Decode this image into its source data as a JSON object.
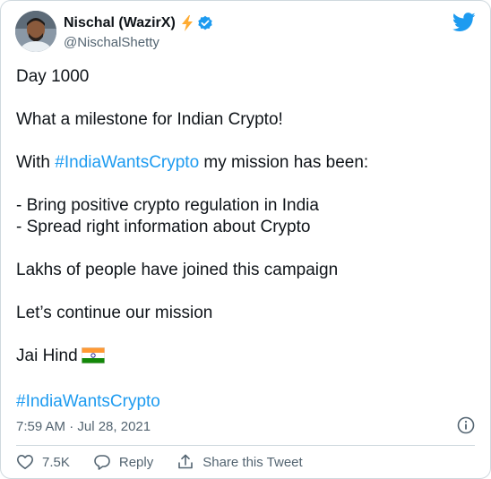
{
  "author": {
    "name": "Nischal (WazirX)",
    "handle": "@NischalShetty",
    "badges": [
      "lightning-bolt-icon",
      "verified-badge-icon"
    ]
  },
  "logo": "twitter-bird-icon",
  "tweet": {
    "lines": {
      "day": "Day 1000",
      "milestone": "What a milestone for Indian Crypto!",
      "mission_prefix": "With ",
      "mission_hashtag": "#IndiaWantsCrypto",
      "mission_suffix": " my mission has been:",
      "bullet_1": "- Bring positive crypto regulation in India",
      "bullet_2": "- Spread right information about Crypto",
      "campaign": "Lakhs of people have joined this campaign",
      "continue": "Let’s continue our mission",
      "jai_hind": "Jai Hind",
      "closing_hashtag": "#IndiaWantsCrypto"
    },
    "flag": "india-flag-icon"
  },
  "meta": {
    "timestamp": "7:59 AM · Jul 28, 2021"
  },
  "actions": {
    "like_count": "7.5K",
    "reply_label": "Reply",
    "share_label": "Share this Tweet"
  },
  "colors": {
    "accent": "#1d9bf0",
    "text": "#0f1419",
    "secondary": "#536471",
    "bolt": "#ffac33"
  }
}
